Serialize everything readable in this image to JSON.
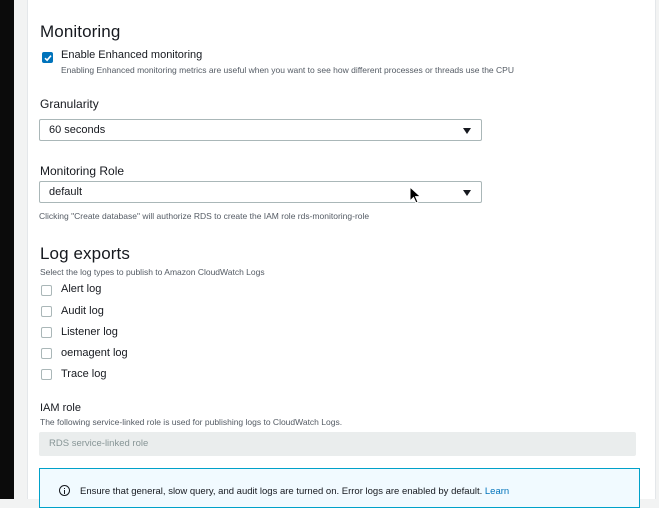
{
  "monitoring": {
    "title": "Monitoring",
    "enhanced_label": "Enable Enhanced monitoring",
    "enhanced_checked": true,
    "enhanced_desc": "Enabling Enhanced monitoring metrics are useful when you want to see how different processes or threads use the CPU",
    "granularity_label": "Granularity",
    "granularity_value": "60 seconds",
    "role_label": "Monitoring Role",
    "role_value": "default",
    "role_desc": "Clicking \"Create database\" will authorize RDS to create the IAM role rds-monitoring-role"
  },
  "log_exports": {
    "title": "Log exports",
    "desc": "Select the log types to publish to Amazon CloudWatch Logs",
    "items": [
      {
        "label": "Alert log",
        "checked": false
      },
      {
        "label": "Audit log",
        "checked": false
      },
      {
        "label": "Listener log",
        "checked": false
      },
      {
        "label": "oemagent log",
        "checked": false
      },
      {
        "label": "Trace log",
        "checked": false
      }
    ]
  },
  "iam_role": {
    "label": "IAM role",
    "desc": "The following service-linked role is used for publishing logs to CloudWatch Logs.",
    "value": "RDS service-linked role"
  },
  "info_alert": {
    "text": "Ensure that general, slow query, and audit logs are turned on. Error logs are enabled by default.",
    "link": "Learn"
  },
  "colors": {
    "accent": "#0073bb",
    "info_border": "#00a1c9"
  }
}
